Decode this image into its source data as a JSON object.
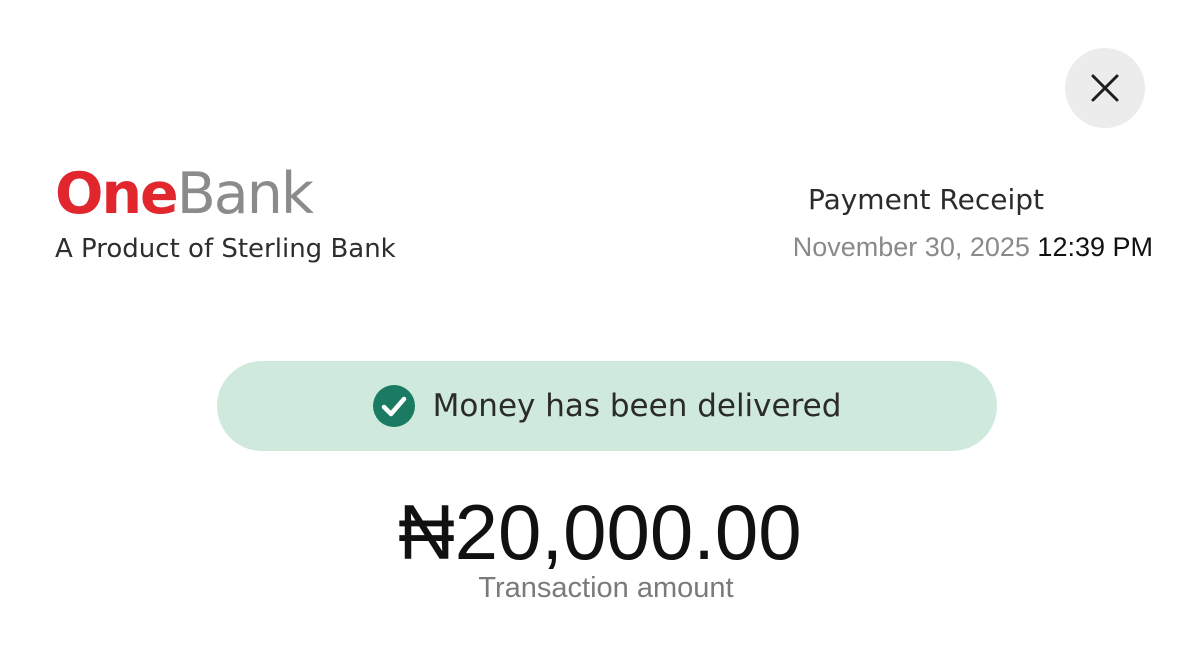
{
  "header": {
    "close_icon": "close-icon"
  },
  "brand": {
    "logo_part1": "One",
    "logo_part2": "Bank",
    "tagline": "A Product of Sterling Bank",
    "colors": {
      "one": "#e1262d",
      "bank": "#8b8b8b"
    }
  },
  "receipt": {
    "title": "Payment Receipt",
    "date": "November 30, 2025",
    "time": "12:39 PM"
  },
  "status": {
    "icon": "check-circle-icon",
    "text": "Money has been delivered",
    "colors": {
      "background": "#cfe9dd",
      "icon": "#1a7a62"
    }
  },
  "transaction": {
    "amount": "₦20,000.00",
    "label": "Transaction amount"
  }
}
